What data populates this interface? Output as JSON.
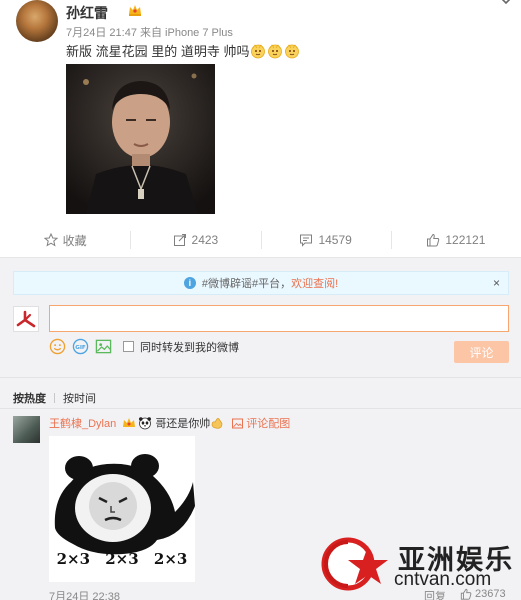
{
  "post": {
    "username": "孙红雷",
    "meta": "7月24日 21:47 来自 iPhone 7 Plus",
    "text": "新版 流星花园 里的 道明寺 帅吗",
    "emojis": [
      "face-emoji",
      "face-emoji",
      "face-emoji"
    ]
  },
  "actions": {
    "favorite": "收藏",
    "repost": "2423",
    "comment": "14579",
    "like": "122121"
  },
  "notice": {
    "text": "#微博辟谣#平台，",
    "link": "欢迎查阅!",
    "close": "×"
  },
  "composer": {
    "forward_label": "同时转发到我的微博",
    "submit_label": "评论"
  },
  "sort": {
    "hot": "按热度",
    "time": "按时间"
  },
  "comments": [
    {
      "user": "王鹤棣_Dylan",
      "text": "哥还是你帅",
      "pic_link": "评论配图",
      "image_caption": [
        "2×3",
        "2×3",
        "2×3"
      ],
      "time": "7月24日 22:38",
      "reply": "回复",
      "likes": "23673"
    }
  ],
  "watermark": {
    "title": "亚洲娱乐",
    "site": "cntvan.com"
  },
  "colors": {
    "accent": "#eb7350",
    "notice_bg": "#eaf8ff",
    "submit_disabled": "#fbc5a6",
    "comment_area_bg": "#f2f2f5"
  }
}
